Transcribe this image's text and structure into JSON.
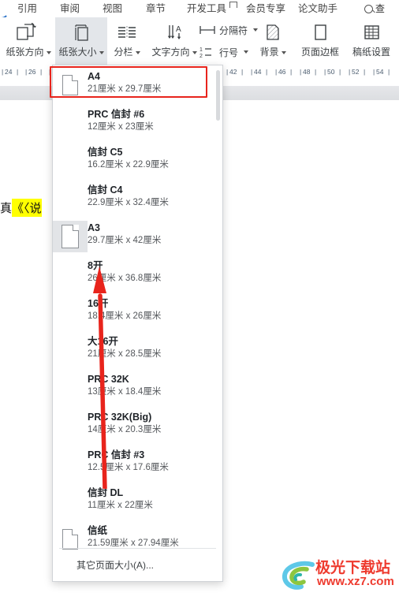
{
  "menubar": {
    "items": [
      {
        "label": "引用"
      },
      {
        "label": "审阅"
      },
      {
        "label": "视图"
      },
      {
        "label": "章节"
      },
      {
        "label": "开发工具"
      },
      {
        "label": "会员专享"
      },
      {
        "label": "论文助手"
      }
    ],
    "search_label": "查"
  },
  "ribbon": {
    "paper_orientation": "纸张方向",
    "paper_size": "纸张大小",
    "columns": "分栏",
    "text_direction": "文字方向",
    "separator": "分隔符",
    "line_number": "行号",
    "background": "背景",
    "page_border": "页面边框",
    "grid_paper": "稿纸设置"
  },
  "ruler": {
    "left_ticks": [
      "24",
      "26"
    ],
    "right_ticks": [
      "42",
      "44",
      "46",
      "48",
      "50",
      "52",
      "54"
    ]
  },
  "document": {
    "visible_text": "真",
    "highlighted_text": "《〈说",
    "highlight_color": "#ffff00"
  },
  "dropdown": {
    "items": [
      {
        "name": "A4",
        "dim": "21厘米  x  29.7厘米",
        "icon": "page-icon",
        "icon_hover": false,
        "selected": true
      },
      {
        "name": "PRC 信封 #6",
        "dim": "12厘米  x  23厘米",
        "icon": "none",
        "icon_hover": false,
        "selected": false
      },
      {
        "name": "信封 C5",
        "dim": "16.2厘米  x  22.9厘米",
        "icon": "none",
        "icon_hover": false,
        "selected": false
      },
      {
        "name": "信封 C4",
        "dim": "22.9厘米  x  32.4厘米",
        "icon": "none",
        "icon_hover": false,
        "selected": false
      },
      {
        "name": "A3",
        "dim": "29.7厘米  x  42厘米",
        "icon": "page-icon",
        "icon_hover": true,
        "selected": false
      },
      {
        "name": "8开",
        "dim": "26厘米  x  36.8厘米",
        "icon": "none",
        "icon_hover": false,
        "selected": false
      },
      {
        "name": "16开",
        "dim": "18.4厘米  x  26厘米",
        "icon": "none",
        "icon_hover": false,
        "selected": false
      },
      {
        "name": "大16开",
        "dim": "21厘米  x  28.5厘米",
        "icon": "none",
        "icon_hover": false,
        "selected": false
      },
      {
        "name": "PRC 32K",
        "dim": "13厘米  x  18.4厘米",
        "icon": "none",
        "icon_hover": false,
        "selected": false
      },
      {
        "name": "PRC 32K(Big)",
        "dim": "14厘米  x  20.3厘米",
        "icon": "none",
        "icon_hover": false,
        "selected": false
      },
      {
        "name": "PRC 信封 #3",
        "dim": "12.5厘米  x  17.6厘米",
        "icon": "none",
        "icon_hover": false,
        "selected": false
      },
      {
        "name": "信封 DL",
        "dim": "11厘米  x  22厘米",
        "icon": "none",
        "icon_hover": false,
        "selected": false
      },
      {
        "name": "信纸",
        "dim": "21.59厘米  x  27.94厘米",
        "icon": "page-icon",
        "icon_hover": false,
        "selected": false
      }
    ],
    "footer_label": "其它页面大小(A)..."
  },
  "annotations": {
    "highlight_box_color": "#e8241c",
    "arrow_color": "#e8241c"
  },
  "watermark": {
    "title": "极光下载站",
    "url": "www.xz7.com"
  }
}
